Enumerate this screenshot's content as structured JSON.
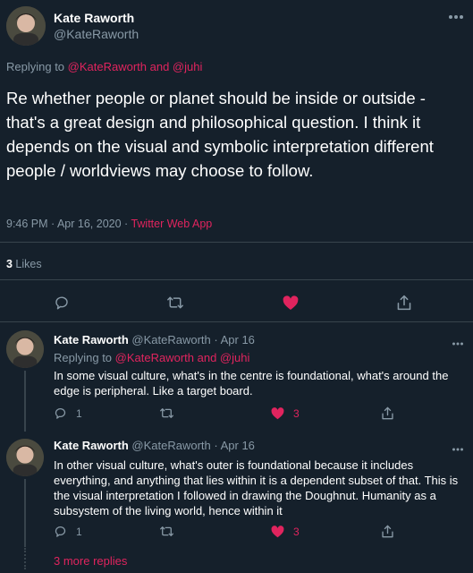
{
  "main": {
    "author_name": "Kate Raworth",
    "author_handle": "@KateRaworth",
    "replying_prefix": "Replying to ",
    "replying_to": "@KateRaworth and @juhi",
    "text": "Re whether people or planet should be inside or outside - that's a great design and philosophical question. I think it depends on the visual and symbolic interpretation different people / worldviews may choose to follow.",
    "time": "9:46 PM · Apr 16, 2020 · ",
    "source": "Twitter Web App",
    "likes_count": "3",
    "likes_label": " Likes"
  },
  "replies": [
    {
      "author_name": "Kate Raworth",
      "meta": "@KateRaworth · Apr 16",
      "replying_prefix": "Replying to ",
      "replying_to": "@KateRaworth and @juhi",
      "text": "In some visual culture, what's in the centre is foundational, what's around the edge is peripheral. Like a target board.",
      "reply_count": "1",
      "like_count": "3"
    },
    {
      "author_name": "Kate Raworth",
      "meta": "@KateRaworth · Apr 16",
      "text": "In other visual culture, what's outer is foundational because it includes everything, and anything that lies within it is a dependent subset of that. This is the visual interpretation I followed in drawing the Doughnut. Humanity as a subsystem of the living world, hence within it",
      "reply_count": "1",
      "like_count": "3"
    }
  ],
  "more_replies": "3 more replies",
  "colors": {
    "background": "#15202b",
    "accent": "#e0245e",
    "muted": "#8899a6",
    "divider": "#38444d"
  },
  "icons": [
    "more-icon",
    "reply-icon",
    "retweet-icon",
    "heart-icon",
    "share-icon"
  ]
}
